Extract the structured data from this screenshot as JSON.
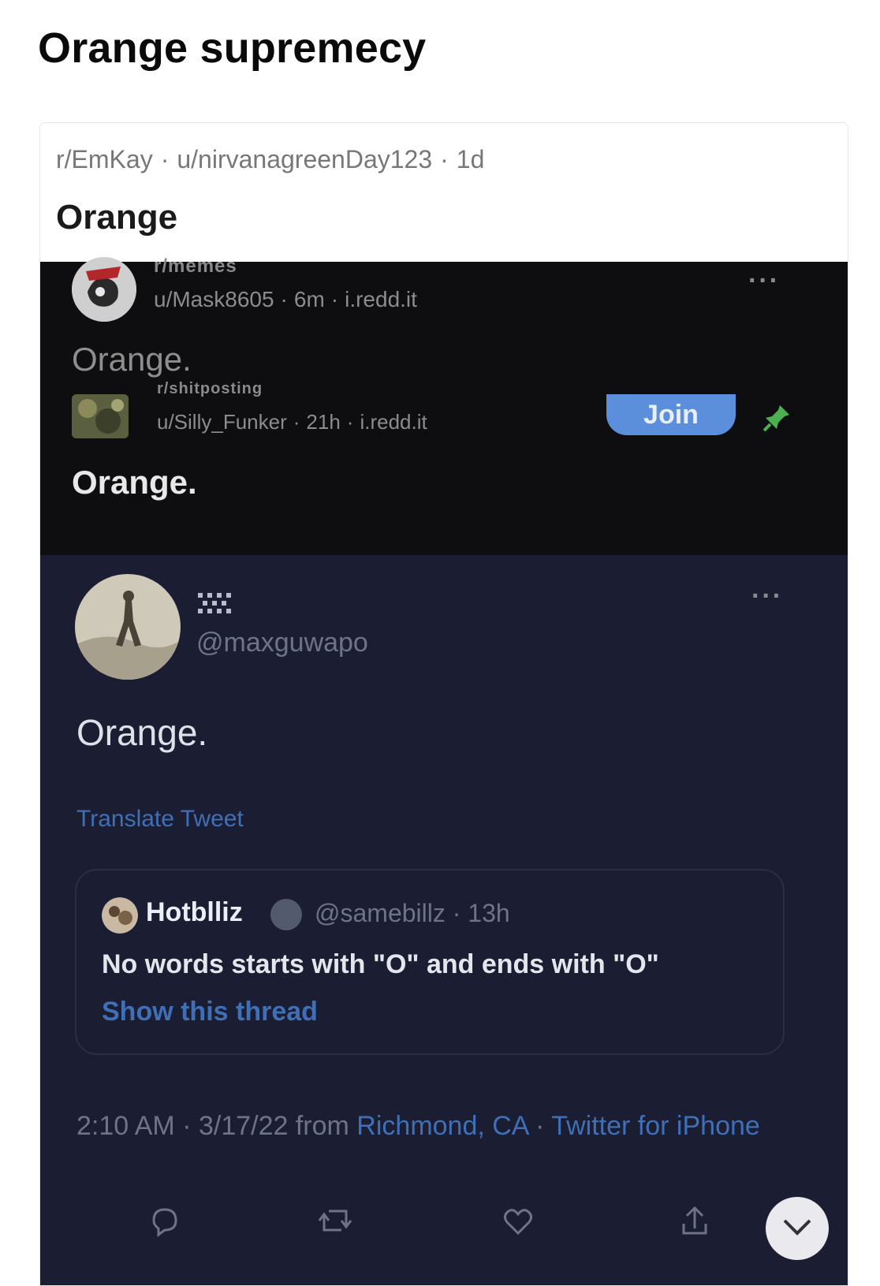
{
  "page": {
    "title": "Orange supremecy"
  },
  "card": {
    "subreddit": "r/EmKay",
    "author": "u/nirvanagreenDay123",
    "age": "1d",
    "title": "Orange"
  },
  "reddit_posts": [
    {
      "subreddit": "r/memes",
      "author": "u/Mask8605",
      "age": "6m",
      "domain": "i.redd.it",
      "title": "Orange.",
      "more": "···"
    },
    {
      "subreddit": "r/shitposting",
      "author": "u/Silly_Funker",
      "age": "21h",
      "domain": "i.redd.it",
      "title": "Orange.",
      "join_label": "Join"
    }
  ],
  "tweet": {
    "handle": "@maxguwapo",
    "text": "Orange.",
    "translate": "Translate Tweet",
    "more": "···",
    "quote": {
      "name": "Hotblliz",
      "handle": "@samebillz · 13h",
      "text": "No words starts with \"O\" and ends with \"O\"",
      "show_thread": "Show this thread"
    },
    "timestamp": "2:10 AM · 3/17/22 from ",
    "location": "Richmond, CA",
    "separator": " · ",
    "client": "Twitter for iPhone"
  },
  "colors": {
    "reddit_bg": "#0e0e10",
    "twitter_bg": "#1b1e33",
    "link": "#3f6fb6",
    "join": "#5b8fdc",
    "pin": "#4caf50"
  }
}
